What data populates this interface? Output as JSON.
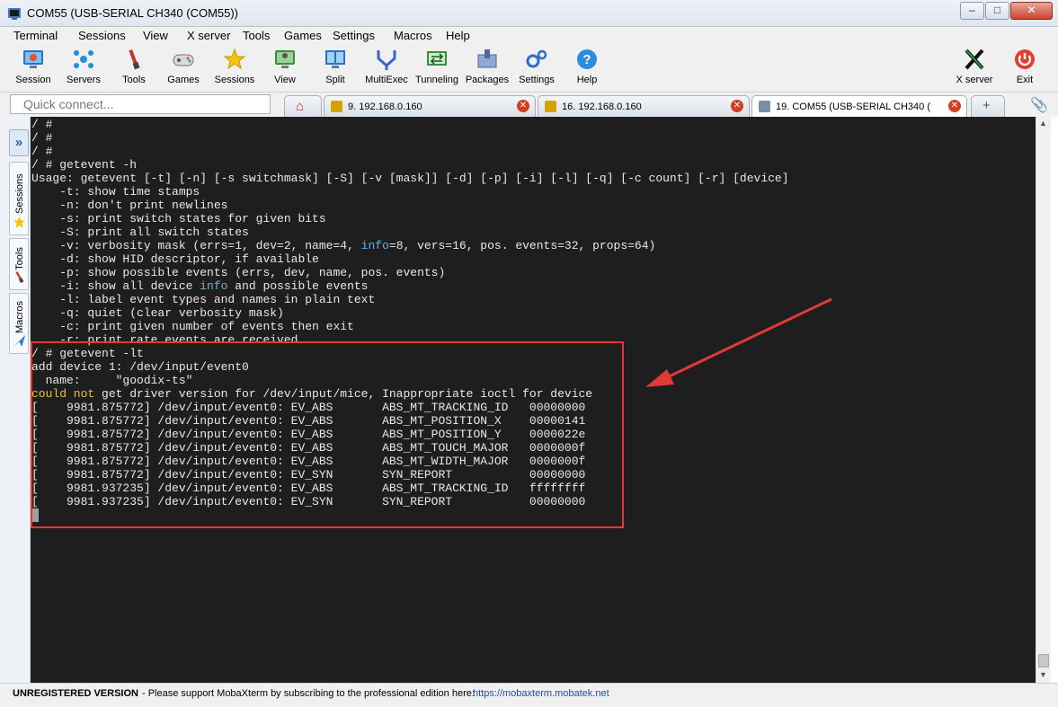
{
  "window": {
    "title": "COM55  (USB-SERIAL CH340 (COM55))",
    "buttons": {
      "minimize": "–",
      "maximize": "□",
      "close": "✕"
    }
  },
  "menu": [
    "Terminal",
    "Sessions",
    "View",
    "X server",
    "Tools",
    "Games",
    "Settings",
    "Macros",
    "Help"
  ],
  "toolbar": {
    "left": [
      {
        "label": "Session",
        "icon": "session-icon"
      },
      {
        "label": "Servers",
        "icon": "servers-icon"
      },
      {
        "label": "Tools",
        "icon": "tools-icon"
      },
      {
        "label": "Games",
        "icon": "games-icon"
      },
      {
        "label": "Sessions",
        "icon": "sessions-star-icon"
      },
      {
        "label": "View",
        "icon": "view-icon"
      },
      {
        "label": "Split",
        "icon": "split-icon"
      },
      {
        "label": "MultiExec",
        "icon": "multiexec-icon"
      },
      {
        "label": "Tunneling",
        "icon": "tunneling-icon"
      },
      {
        "label": "Packages",
        "icon": "packages-icon"
      },
      {
        "label": "Settings",
        "icon": "settings-icon"
      },
      {
        "label": "Help",
        "icon": "help-icon"
      }
    ],
    "right": [
      {
        "label": "X server",
        "icon": "x-server-icon"
      },
      {
        "label": "Exit",
        "icon": "exit-icon"
      }
    ]
  },
  "quick_connect": {
    "placeholder": "Quick connect..."
  },
  "tabs": [
    {
      "label": "9. 192.168.0.160"
    },
    {
      "label": "16. 192.168.0.160"
    },
    {
      "label": "19. COM55  (USB-SERIAL CH340 (",
      "active": true
    }
  ],
  "sidebar": {
    "tabs": [
      "Sessions",
      "Tools",
      "Macros"
    ]
  },
  "terminal": {
    "lines": [
      [
        {
          "t": "/ #"
        }
      ],
      [
        {
          "t": "/ #"
        }
      ],
      [
        {
          "t": "/ #"
        }
      ],
      [
        {
          "t": "/ # getevent -h"
        }
      ],
      [
        {
          "t": "Usage: getevent [-t] [-n] [-s switchmask] [-S] [-v [mask]] [-d] [-p] [-i] [-l] [-q] [-c count] [-r] [device]"
        }
      ],
      [
        {
          "t": "    -t: show time stamps"
        }
      ],
      [
        {
          "t": "    -n: don't print newlines"
        }
      ],
      [
        {
          "t": "    -s: print switch states for given bits"
        }
      ],
      [
        {
          "t": "    -S: print all switch states"
        }
      ],
      [
        {
          "t": "    -v: verbosity mask (errs=1, dev=2, name=4, "
        },
        {
          "t": "info",
          "c": "blue"
        },
        {
          "t": "=8, vers=16, pos. events=32, props=64)"
        }
      ],
      [
        {
          "t": "    -d: show HID descriptor, if available"
        }
      ],
      [
        {
          "t": "    -p: show possible events (errs, dev, name, pos. events)"
        }
      ],
      [
        {
          "t": "    -i: show all device "
        },
        {
          "t": "info",
          "c": "blue"
        },
        {
          "t": " and possible events"
        }
      ],
      [
        {
          "t": "    -l: label event types and names in plain text"
        }
      ],
      [
        {
          "t": "    -q: quiet (clear verbosity mask)"
        }
      ],
      [
        {
          "t": "    -c: print given number of events then exit"
        }
      ],
      [
        {
          "t": "    -r: print rate events are received"
        }
      ],
      [
        {
          "t": "/ # getevent -lt"
        }
      ],
      [
        {
          "t": "add device 1: /dev/input/event0"
        }
      ],
      [
        {
          "t": "  name:     \"goodix-ts\""
        }
      ],
      [
        {
          "t": "could not",
          "c": "yellow"
        },
        {
          "t": " get driver version for /dev/input/mice, Inappropriate ioctl for device"
        }
      ],
      [
        {
          "t": "[    9981.875772] /dev/input/event0: EV_ABS       ABS_MT_TRACKING_ID   00000000"
        }
      ],
      [
        {
          "t": "[    9981.875772] /dev/input/event0: EV_ABS       ABS_MT_POSITION_X    00000141"
        }
      ],
      [
        {
          "t": "[    9981.875772] /dev/input/event0: EV_ABS       ABS_MT_POSITION_Y    0000022e"
        }
      ],
      [
        {
          "t": "[    9981.875772] /dev/input/event0: EV_ABS       ABS_MT_TOUCH_MAJOR   0000000f"
        }
      ],
      [
        {
          "t": "[    9981.875772] /dev/input/event0: EV_ABS       ABS_MT_WIDTH_MAJOR   0000000f"
        }
      ],
      [
        {
          "t": "[    9981.875772] /dev/input/event0: EV_SYN       SYN_REPORT           00000000"
        }
      ],
      [
        {
          "t": "[    9981.937235] /dev/input/event0: EV_ABS       ABS_MT_TRACKING_ID   ffffffff"
        }
      ],
      [
        {
          "t": "[    9981.937235] /dev/input/event0: EV_SYN       SYN_REPORT           00000000"
        }
      ]
    ]
  },
  "statusbar": {
    "unregistered": "UNREGISTERED VERSION",
    "message": " -  Please support MobaXterm by subscribing to the professional edition here:",
    "link": "https://mobaxterm.mobatek.net"
  },
  "colors": {
    "terminal_bg": "#1e1e1e",
    "terminal_fg": "#e8e8e8",
    "info_blue": "#5fb4e0",
    "warn_yellow": "#e8c230",
    "annotation_red": "#e03a36"
  }
}
